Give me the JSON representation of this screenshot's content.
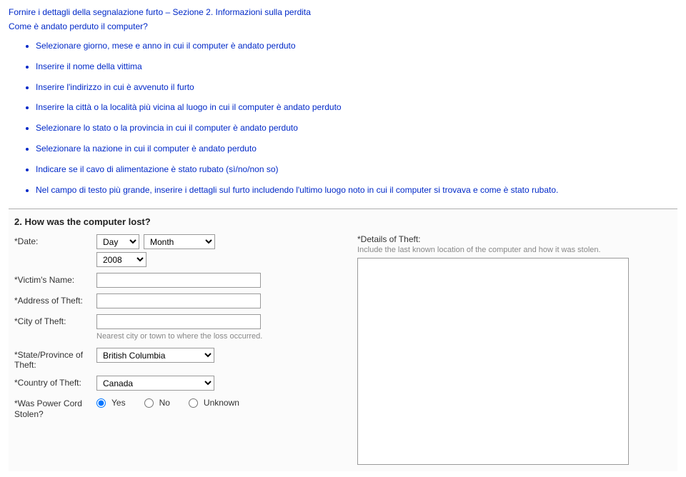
{
  "intro": {
    "title": "Fornire i dettagli della segnalazione furto – Sezione 2. Informazioni sulla perdita",
    "question": "Come è andato perduto il computer?"
  },
  "instructions": [
    "Selezionare giorno, mese e anno in cui il computer è andato perduto",
    "Inserire il nome della vittima",
    "Inserire l'indirizzo in cui è avvenuto il furto",
    "Inserire la città o la località più vicina al luogo in cui il computer è andato perduto",
    "Selezionare lo stato o la provincia in cui il computer è andato perduto",
    "Selezionare la nazione in cui il computer è andato perduto",
    "Indicare se il cavo di alimentazione è stato rubato (sì/no/non so)",
    "Nel campo di testo più grande, inserire i dettagli sul furto includendo l'ultimo luogo noto in cui il computer si trovava e come è stato rubato."
  ],
  "form": {
    "sectionTitle": "2. How was the computer lost?",
    "dateLabel": "*Date:",
    "daySelected": "Day",
    "monthSelected": "Month",
    "yearSelected": "2008",
    "victimLabel": "*Victim's Name:",
    "victimValue": "",
    "addressLabel": "*Address of Theft:",
    "addressValue": "",
    "cityLabel": "*City of Theft:",
    "cityValue": "",
    "cityNote": "Nearest city or town to where the loss occurred.",
    "stateLabel": "*State/Province of Theft:",
    "stateSelected": "British Columbia",
    "countryLabel": "*Country of Theft:",
    "countrySelected": "Canada",
    "powerLabel": "*Was Power Cord Stolen?",
    "radioYes": "Yes",
    "radioNo": "No",
    "radioUnknown": "Unknown",
    "detailsLabel": "*Details of Theft:",
    "detailsNote": "Include the last known location of the computer and how it was stolen.",
    "detailsValue": ""
  }
}
